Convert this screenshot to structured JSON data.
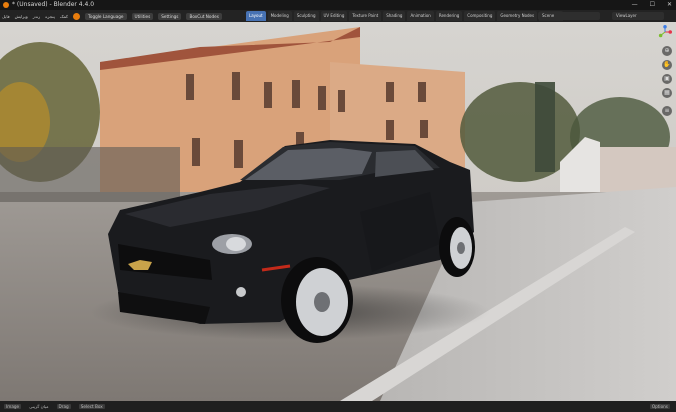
{
  "window": {
    "title": "* (Unsaved) - Blender 4.4.0",
    "controls": [
      "—",
      "☐",
      "✕"
    ]
  },
  "menubar": {
    "items": [
      "فایل",
      "ویرایش",
      "رندر",
      "پنجره",
      "کمک"
    ],
    "language_label": "Toggle Language",
    "utilities_label": "Utilities",
    "settings_label": "Settings",
    "boxcut_label": "BoxCut Nodes"
  },
  "workspace_tabs": [
    "Layout",
    "Modeling",
    "Sculpting",
    "UV Editing",
    "Texture Paint",
    "Shading",
    "Animation",
    "Rendering",
    "Compositing",
    "Geometry Nodes",
    "Scripting"
  ],
  "active_tab": "Layout",
  "scene": {
    "name": "Scene",
    "view_layer": "ViewLayer"
  },
  "statusbar": {
    "left": [
      "Image",
      "میان گزینی",
      "Drag",
      "Select Box"
    ],
    "right": "Options"
  },
  "colors": {
    "accent": "#4772b3",
    "brand": "#e87d0d"
  }
}
